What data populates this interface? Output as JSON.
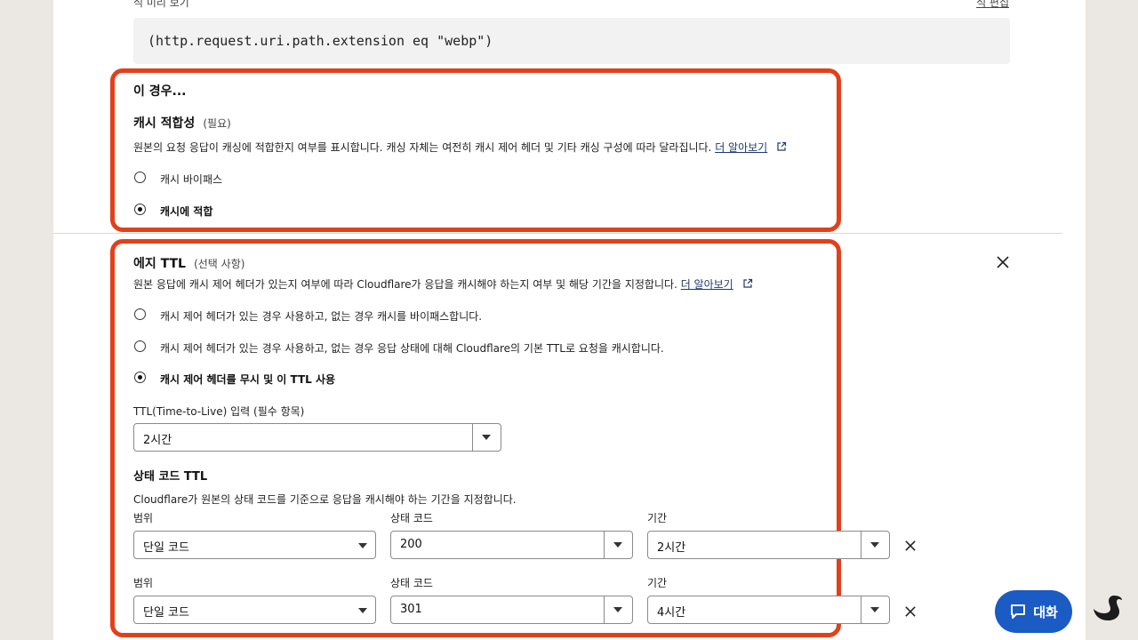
{
  "top": {
    "cutoff_label": "식 미리 보기",
    "cutoff_link": "식 편집",
    "expression": "(http.request.uri.path.extension eq \"webp\")"
  },
  "then_section": {
    "heading": "이 경우...",
    "cache_eligibility": {
      "title": "캐시 적합성",
      "tag": "(필요)",
      "description": "원본의 요청 응답이 캐싱에 적합한지 여부를 표시합니다. 캐싱 자체는 여전히 캐시 제어 헤더 및 기타 캐싱 구성에 따라 달라집니다.",
      "learn_more": "더 알아보기",
      "options": [
        {
          "label": "캐시 바이패스",
          "selected": false
        },
        {
          "label": "캐시에 적합",
          "selected": true
        }
      ]
    }
  },
  "edge_ttl": {
    "title": "에지 TTL",
    "tag": "(선택 사항)",
    "description": "원본 응답에 캐시 제어 헤더가 있는지 여부에 따라 Cloudflare가 응답을 캐시해야 하는지 여부 및 해당 기간을 지정합니다.",
    "learn_more": "더 알아보기",
    "options": [
      {
        "label": "캐시 제어 헤더가 있는 경우 사용하고, 없는 경우 캐시를 바이패스합니다.",
        "selected": false
      },
      {
        "label": "캐시 제어 헤더가 있는 경우 사용하고, 없는 경우 응답 상태에 대해 Cloudflare의 기본 TTL로 요청을 캐시합니다.",
        "selected": false
      },
      {
        "label": "캐시 제어 헤더를 무시 및 이 TTL 사용",
        "selected": true
      }
    ],
    "ttl_label": "TTL(Time-to-Live) 입력 (필수 항목)",
    "ttl_value": "2시간",
    "status_ttl": {
      "title": "상태 코드 TTL",
      "description": "Cloudflare가 원본의 상태 코드를 기준으로 응답을 캐시해야 하는 기간을 지정합니다.",
      "col_scope": "범위",
      "col_code": "상태 코드",
      "col_duration": "기간",
      "rows": [
        {
          "scope": "단일 코드",
          "code": "200",
          "duration": "2시간"
        },
        {
          "scope": "단일 코드",
          "code": "301",
          "duration": "4시간"
        }
      ]
    }
  },
  "chat": {
    "label": "대화"
  },
  "colors": {
    "highlight": "#e2401c",
    "chat_bg": "#1a5bc4",
    "link": "#1e3a6e"
  },
  "icons": [
    "external-link-icon",
    "close-icon",
    "chevron-down-icon",
    "chat-icon",
    "swan-logo-icon"
  ]
}
